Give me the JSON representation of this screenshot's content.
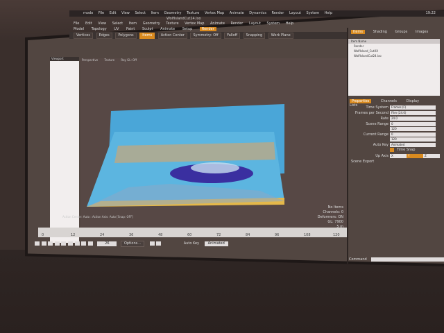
{
  "system_bar": {
    "app": "modo",
    "menus": [
      "File",
      "Edit",
      "View",
      "Select",
      "Item",
      "Geometry",
      "Texture",
      "Vertex Map",
      "Animate",
      "Dynamics",
      "Render",
      "Layout",
      "System",
      "Help"
    ],
    "clock": "19:22"
  },
  "window_title": "WolfIslandCut24.lxo",
  "menubar": [
    "File",
    "Edit",
    "View",
    "Select",
    "Item",
    "Geometry",
    "Texture",
    "Vertex Map",
    "Animate",
    "Render",
    "Layout",
    "System",
    "Help"
  ],
  "layout_tabs": {
    "items": [
      "Model",
      "Topology",
      "UV",
      "Paint",
      "Sculpt",
      "Animate",
      "Setup",
      "Render"
    ],
    "active": "Render"
  },
  "toolbar": {
    "items": [
      "Vertices",
      "Edges",
      "Polygons",
      "Items",
      "Action Center",
      "Symmetry: Off",
      "Falloff",
      "Snapping",
      "Work Plane"
    ]
  },
  "viewport": {
    "left_panel_title": "Viewport",
    "tabs": [
      "Perspective",
      "Texture",
      "Ray GL: Off"
    ],
    "caption": "Action Center: Auto : Action Axis: Auto  [Snap: OFF]",
    "info": [
      "No Items",
      "Channels: 0",
      "Deformers: ON",
      "GL: 7900",
      "5 m"
    ]
  },
  "timeline": {
    "ticks": [
      "0",
      "12",
      "24",
      "36",
      "48",
      "60",
      "72",
      "84",
      "96",
      "108",
      "120"
    ],
    "current_frame": "26",
    "options_label": "Options...",
    "auto_key_label": "Auto Key",
    "auto_key_value": "Animated"
  },
  "right_panel": {
    "tabs": [
      "Items",
      "Shading",
      "Groups",
      "Images"
    ],
    "active_tab": "Items",
    "items_header": "Item Name",
    "items": [
      "Render",
      "WolfIsland_CutXX",
      "WolfIslandCut24.lxo"
    ],
    "prop_tabs": [
      "Properties",
      "Channels",
      "Display",
      "Lists"
    ],
    "active_prop_tab": "Properties",
    "props": {
      "time_system": {
        "label": "Time System",
        "value": "Frames (F)"
      },
      "fps": {
        "label": "Frames per Second",
        "value": "Film (24.0)"
      },
      "rate": {
        "label": "Rate",
        "value": "24.0"
      },
      "scene_range": {
        "label": "Scene Range",
        "start": "0",
        "end": "120"
      },
      "current_range": {
        "label": "Current Range",
        "start": "0",
        "end": "120"
      },
      "auto_key": {
        "label": "Auto Key",
        "value": "Animated"
      },
      "time_snap": {
        "label": "Time Snap"
      },
      "up_axis": {
        "label": "Up Axis",
        "x": "X",
        "y": "Y",
        "z": "Z"
      },
      "scene_export": "Scene Export"
    },
    "command_label": "Command"
  },
  "colors": {
    "accent": "#d98a1f",
    "mesh_water": "#4aa6d8",
    "mesh_deep": "#3a2fa0"
  }
}
